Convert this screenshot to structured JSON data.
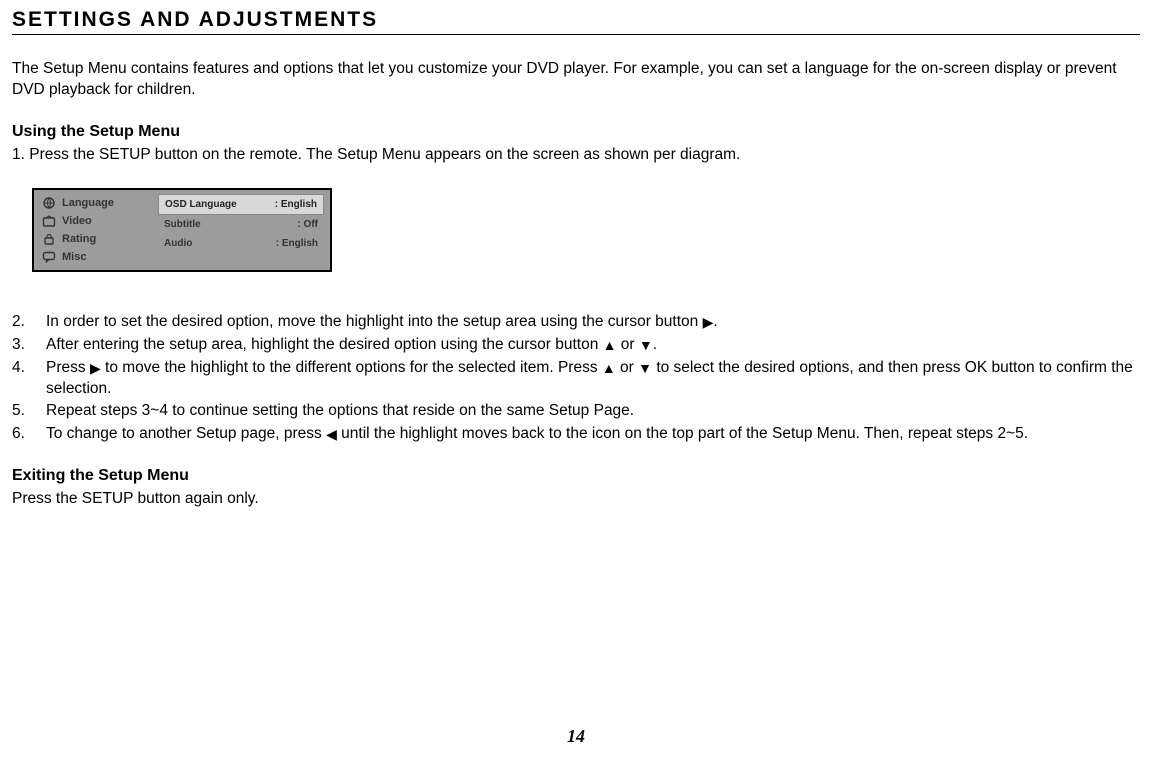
{
  "title": "SETTINGS AND ADJUSTMENTS",
  "intro": "The Setup Menu contains features and options that let you customize your DVD player. For example, you can set a language for the on-screen display or prevent DVD playback for children.",
  "using_title": "Using the Setup Menu",
  "step1": "1.  Press the SETUP button on the remote. The Setup Menu appears on the screen as shown per diagram.",
  "setup_menu": {
    "left": [
      "Language",
      "Video",
      "Rating",
      "Misc"
    ],
    "right": [
      {
        "label": "OSD Language",
        "value": ": English",
        "hl": true
      },
      {
        "label": "Subtitle",
        "value": ": Off",
        "hl": false
      },
      {
        "label": "Audio",
        "value": ": English",
        "hl": false
      }
    ]
  },
  "steps": {
    "s2a": "In order to set the desired option, move the highlight into the setup area using the cursor button ",
    "s2b": ".",
    "s3a": "After entering the setup area, highlight the desired option using the cursor button ",
    "s3b": " or ",
    "s3c": ".",
    "s4a": "Press ",
    "s4b": " to move the highlight to the different options for the selected item. Press ",
    "s4c": " or ",
    "s4d": " to select the desired options, and then press OK button to confirm the selection.",
    "s5": "Repeat steps 3~4 to continue setting the options that reside on the same Setup Page.",
    "s6a": "To change to another Setup page, press ",
    "s6b": " until the highlight moves back to the icon on the top part of the Setup Menu. Then, repeat steps 2~5."
  },
  "exit_title": "Exiting the Setup Menu",
  "exit_text": "Press the SETUP button again only.",
  "page_number": "14",
  "arrows": {
    "right": "▶",
    "left": "◀",
    "up": "▲",
    "down": "▼"
  }
}
